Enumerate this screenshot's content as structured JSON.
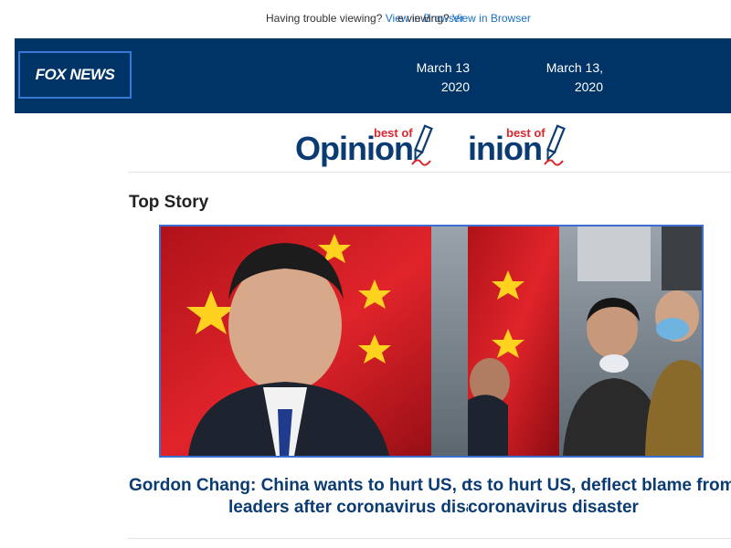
{
  "trouble_bar": {
    "text": "Having trouble viewing?",
    "link": "View in Browser",
    "partial_text": "e viewing?",
    "partial_link": "View in Browser"
  },
  "header": {
    "logo": "FOX NEWS",
    "date_line1": "March 13,",
    "date_line2": "2020",
    "date_partial_line1": "March 13",
    "date_partial_line2": "2020"
  },
  "opinion_logo": {
    "word": "Opinion",
    "partial_word": "inion",
    "tag": "best of"
  },
  "top_story": {
    "section_title": "Top Story",
    "headline_line1": "Gordon Chang: China wants to hurt US, deflect blame from",
    "headline_line2": "leaders after coronavirus disaster",
    "headline_partial_line1": "Gordon Chang: China wants to hurt US, de",
    "headline_partial_line1b": "ts to hurt US, deflect blame from",
    "headline_partial_line2": "leaders after coronavirus disa",
    "headline_partial_line2b": "coronavirus disaster"
  },
  "colors": {
    "header_bg": "#003366",
    "link": "#1a6fc2",
    "headline": "#0b3b73",
    "opinion_red": "#d9272e"
  }
}
